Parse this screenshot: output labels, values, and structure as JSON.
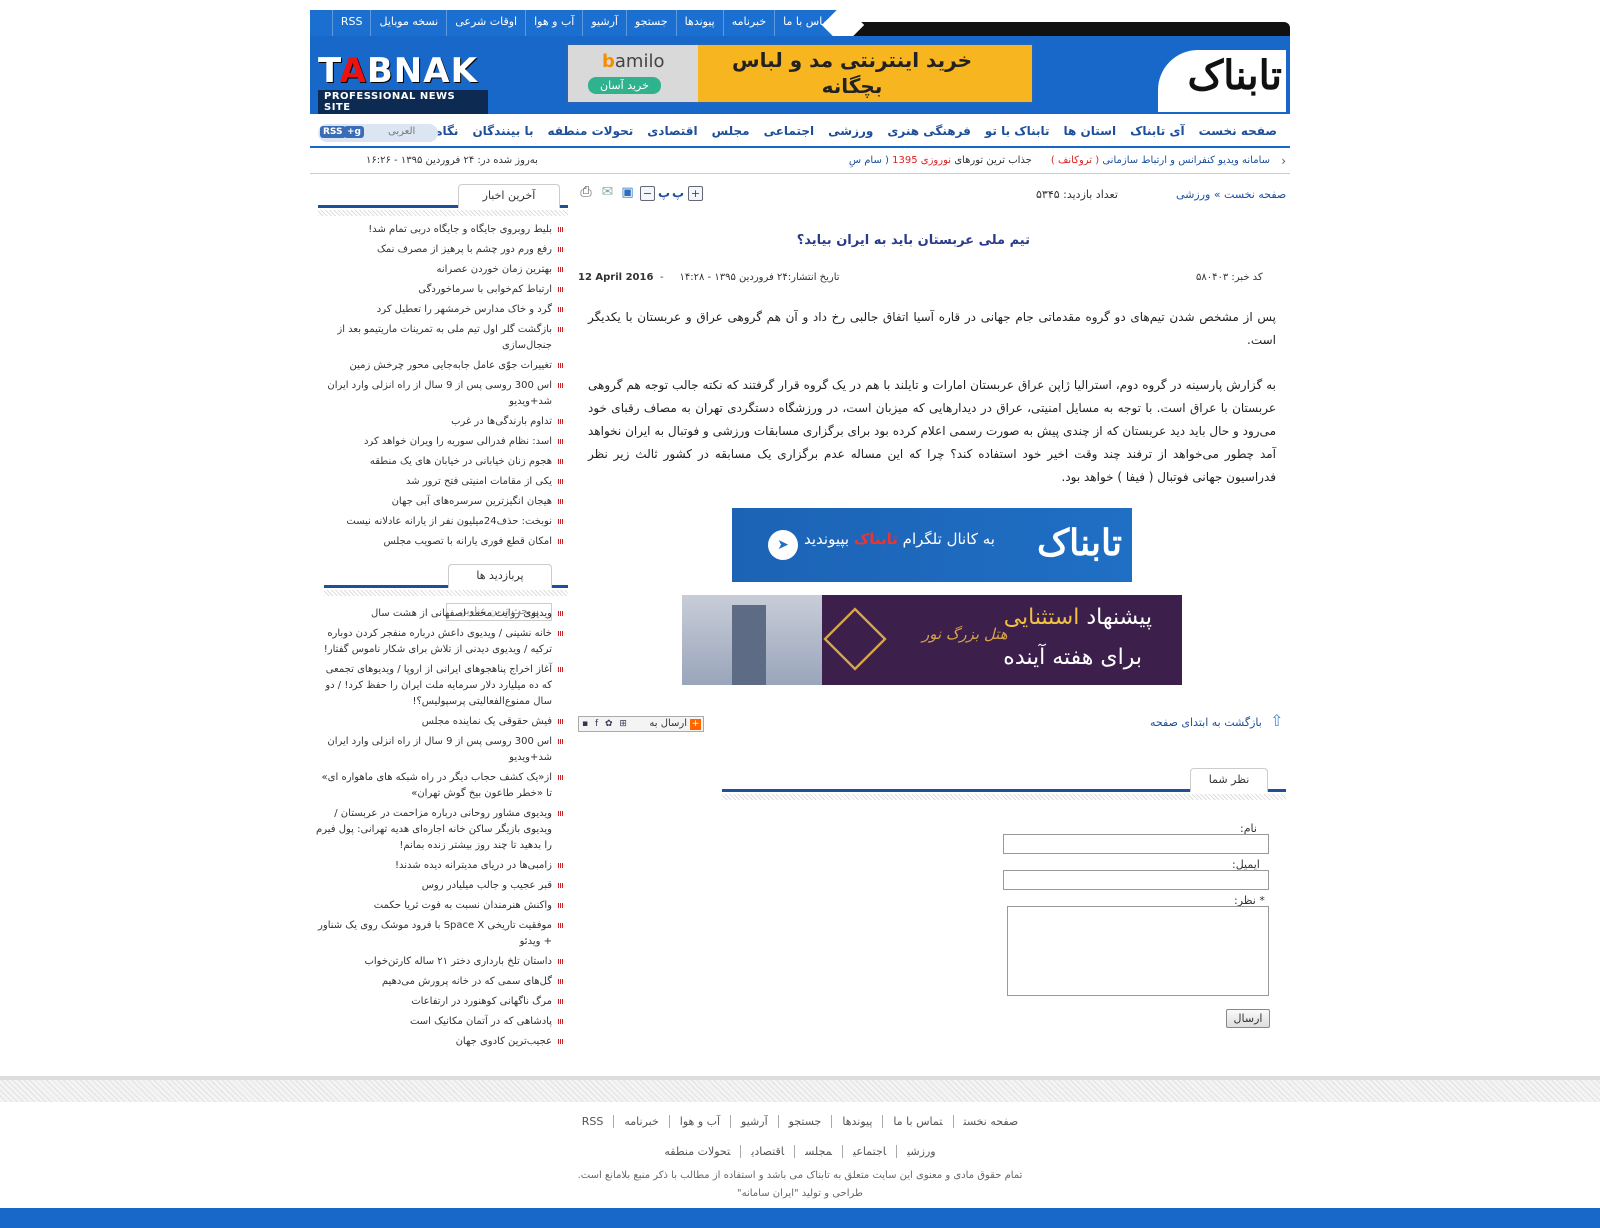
{
  "topnav": [
    "تماس با ما",
    "خبرنامه",
    "پیوندها",
    "جستجو",
    "آرشیو",
    "آب و هوا",
    "اوقات شرعی",
    "نسخه موبایل",
    "RSS"
  ],
  "header": {
    "logo_left_big": "TABNAK",
    "logo_left_small": "PROFESSIONAL NEWS SITE",
    "logo_right": "تابناک",
    "banner_brand": "bamilo",
    "banner_cart": "خرید آسان",
    "banner_text": "خرید اینترنتی مد و لباس بچگانه"
  },
  "menu": [
    "صفحه نخست",
    "آی تابناک",
    "استان ها",
    "تابناک با تو",
    "فرهنگی هنری",
    "ورزشی",
    "اجتماعی",
    "مجلس",
    "اقتصادی",
    "تحولات منطقه",
    "با بینندگان",
    "نگاه شما"
  ],
  "rssbox": {
    "rss": "RSS",
    "gplus": "+g",
    "arabic": "العربی"
  },
  "ticker": {
    "item1": "سامانه ویدیو کنفرانس و ارتباط سازمانی",
    "item1_brand": "( تروکانف )",
    "item2_pre": "جذاب ترین تورهای",
    "item2_highlight": "نوروزی 1395",
    "item2_brand": "( سام سِ",
    "updated": "به‌روز شده در: ۲۴ فروردین ۱۳۹۵ - ۱۶:۲۶"
  },
  "breadcrumb": "صفحه نخست » ورزشی",
  "visits": "تعداد بازدید: ۵۳۴۵",
  "tools": {
    "print": "پ",
    "print2": "پ"
  },
  "article": {
    "title": "تیم ملی عربستان باید به ایران بیاید؟",
    "code": "کد خبر: ۵۸۰۴۰۳",
    "published": "تاریخ انتشار:۲۴ فروردین ۱۳۹۵ - ۱۴:۲۸",
    "published_sep": "-",
    "date_en": "12 April 2016",
    "para1": "پس از مشخص شدن تیم‌های دو گروه مقدماتی جام جهانی در قاره آسیا اتفاق جالبی رخ داد و آن هم گروهی عراق و عربستان با یکدیگر است.",
    "para2": "به گزارش پارسینه در گروه دوم، استرالیا ژاپن عراق عربستان امارات و تایلند با هم در یک گروه قرار گرفتند که نکته جالب توجه هم گروهی عربستان با عراق است. با توجه به مسایل امنیتی، عراق در دیدارهایی که میزبان است، در ورزشگاه دستگردی تهران به مصاف رقبای خود می‌رود و حال باید دید عربستان که از چندی پیش به صورت رسمی اعلام کرده بود برای برگزاری مسابقات ورزشی و فوتبال به ایران نخواهد آمد چطور می‌خواهد از ترفند چند وقت اخیر خود استفاده کند؟ چرا که این مساله عدم برگزاری یک مسابقه در کشور ثالث زیر نظر فدراسیون جهانی فوتبال ( فیفا ) خواهد بود."
  },
  "tg_banner": {
    "text_pre": "به کانال تلگرام",
    "text_brand": "تابناک",
    "text_post": "بپیوندید",
    "logo": "تابناک"
  },
  "ad_banner": {
    "brand": "هتل بزرگ نور",
    "line1_pre": "پیشنهاد",
    "line1_highlight": "استثنایی",
    "line2": "برای هفته آینده"
  },
  "sendto": "ارسال به",
  "backtop": "بازگشت به ابتدای صفحه",
  "comments": {
    "header": "نظر شما",
    "name": "نام:",
    "email": "ایمیل:",
    "comment": "* نظر:",
    "send": "ارسال"
  },
  "sidebar": {
    "latest_header": "آخرین اخبار",
    "latest": [
      "بلیط روبروی جایگاه و جایگاه دربی تمام شد!",
      "رفع ورم دور چشم با پرهیز از مصرف نمک",
      "بهترین زمان خوردن عصرانه",
      "ارتباط کم‌خوابی با سرماخوردگی",
      "گرد و خاک مدارس خرمشهر را تعطیل کرد",
      "بازگشت گلر اول تیم ملی به تمرینات ماریتیمو بعد از جنجال‌سازی",
      "تغییرات جوّی عامل جابه‌جایی محور چرخش زمین",
      "اس 300 روسی پس از 9 سال از راه انزلی وارد ایران شد+ویدیو",
      "تداوم بارندگی‌ها در غرب",
      "اسد: نظام فدرالی سوریه را ویران خواهد کرد",
      "هجوم زنان خیابانی در خیابان های یک منطقه",
      "یکی از مقامات امنیتی فتح ترور شد",
      "هیجان انگیزترین سرسره‌های آبی جهان",
      "نوبخت: حذف24میلیون نفر از یارانه عادلانه نیست",
      "امکان قطع فوری یارانه با تصویب مجلس"
    ],
    "popular_header": "پربازدید ها",
    "popular_subtab": "پربحث ترین عناوین",
    "popular": [
      "ویدیوی روایت محمد اصفهانی از هشت سال",
      "خانه نشینی / ویدیوی داعش درباره منفجر کردن دوباره ترکیه / ویدیوی دیدنی از تلاش برای شکار ناموس گفتار!",
      "آغاز اخراج پناهجوهای ایرانی از اروپا / ویدیوهای تجمعی که ده میلیارد دلار سرمایه ملت ایران را حفظ کرد! / دو سال ممنوع‌الفعالیتی پرسپولیس؟!",
      "فیش حقوقی یک نماینده مجلس",
      "اس 300 روسی پس از 9 سال از راه انزلی وارد ایران شد+ویدیو",
      "از«یک کشف حجاب دیگر در راه شبکه های ماهواره ای» تا «خطر طاعون بیخ گوش تهران»",
      "ویدیوی مشاور روحانی درباره مزاحمت در عربستان / ویدیوی بازیگر ساکن خانه اجاره‌ای هدیه تهرانی: پول فیرم را بدهید تا چند روز بیشتر زنده بمانم!",
      "زامبی‌ها در دریای مدیترانه دیده شدند!",
      "قبر عجیب و جالب میلیادر روس",
      "واکنش هنرمندان نسبت به فوت ثریا حکمت",
      "موفقیت تاریخی Space X با فرود موشک روی یک شناور + ویدئو",
      "داستان تلخ بارداری دختر ۲۱ ساله کارتن‌خواب",
      "گل‌های سمی که در خانه پرورش می‌دهیم",
      "مرگ ناگهانی کوهنورد در ارتفاعات",
      "پادشاهی که در آتمان مکانیک است",
      "عجیب‌ترین کادوی جهان"
    ]
  },
  "footer": {
    "row1": [
      "صفحه نخست",
      "تماس با ما",
      "پیوندها",
      "جستجو",
      "آرشیو",
      "آب و هوا",
      "خبرنامه",
      "RSS"
    ],
    "row2": [
      "ورزشی",
      "اجتماعی",
      "مجلس",
      "اقتصادی",
      "تحولات منطقه"
    ],
    "copyright": "تمام حقوق مادی و معنوی این سایت متعلق به تابناک می باشد و استفاده از مطالب با ذکر منبع بلامانع است.",
    "design": "طراحی و تولید \"ایران سامانه\""
  }
}
